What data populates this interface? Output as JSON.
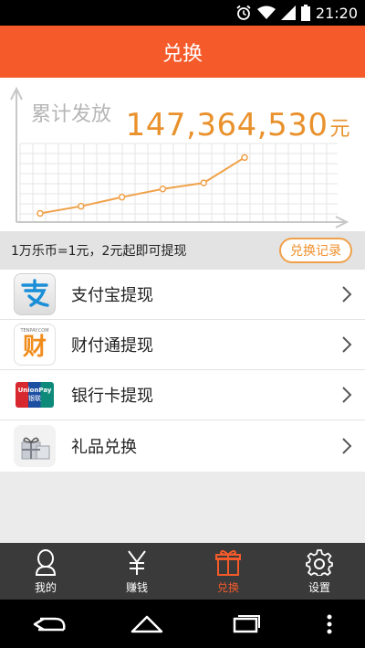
{
  "status_bar": {
    "time": "21:20",
    "icons": [
      "alarm-icon",
      "wifi-icon",
      "signal-icon",
      "battery-icon"
    ]
  },
  "header": {
    "title": "兑换"
  },
  "summary": {
    "label": "累计发放",
    "total": "147,364,530",
    "unit": "元",
    "accent_color": "#e9912c"
  },
  "chart_data": {
    "type": "line",
    "title": "",
    "x": [
      1,
      2,
      3,
      4,
      5,
      6
    ],
    "series": [
      {
        "values": [
          1,
          2.4,
          4.2,
          5.8,
          7,
          12
        ]
      }
    ],
    "grid": true
  },
  "info": {
    "rule": "1万乐币=1元，2元起即可提现",
    "record_button": "兑换记录"
  },
  "menu": [
    {
      "label": "支付宝提现",
      "icon": "alipay-icon"
    },
    {
      "label": "财付通提现",
      "icon": "tenpay-icon",
      "icon_text": "财",
      "icon_caption": "TENPAY.COM"
    },
    {
      "label": "银行卡提现",
      "icon": "unionpay-icon",
      "icon_text": "UnionPay",
      "icon_caption": "银联"
    },
    {
      "label": "礼品兑换",
      "icon": "gift-box-icon"
    }
  ],
  "tabs": [
    {
      "label": "我的",
      "icon": "person-icon"
    },
    {
      "label": "赚钱",
      "icon": "yen-icon"
    },
    {
      "label": "兑换",
      "icon": "gift-icon",
      "active": true
    },
    {
      "label": "设置",
      "icon": "gear-icon"
    }
  ],
  "colors": {
    "brand": "#f45a2a",
    "tabbar": "#3a3a3a"
  }
}
